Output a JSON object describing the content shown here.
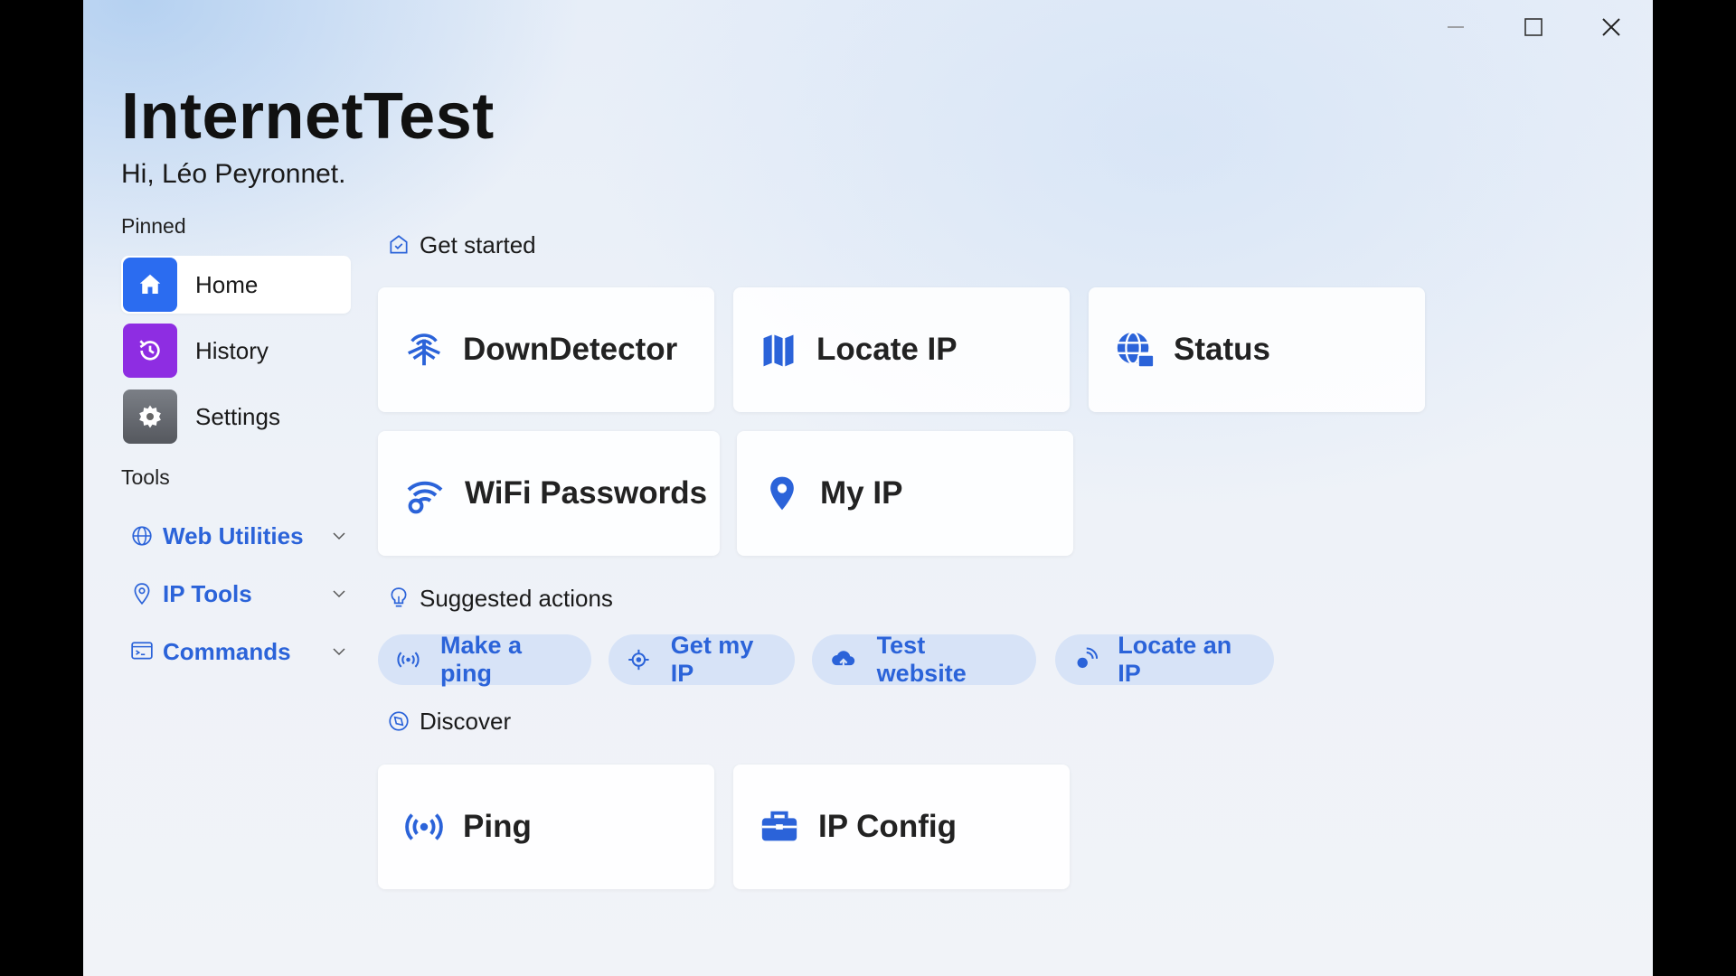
{
  "app": {
    "title": "InternetTest",
    "greeting": "Hi, Léo Peyronnet."
  },
  "sidebar": {
    "pinned_label": "Pinned",
    "pinned": [
      {
        "label": "Home",
        "icon": "home-icon",
        "color": "#2b6cf0",
        "active": true
      },
      {
        "label": "History",
        "icon": "history-icon",
        "color": "#8e2de2",
        "active": false
      },
      {
        "label": "Settings",
        "icon": "gear-icon",
        "color": "#6b6f76",
        "active": false
      }
    ],
    "tools_label": "Tools",
    "tools": [
      {
        "label": "Web Utilities",
        "icon": "globe-icon"
      },
      {
        "label": "IP Tools",
        "icon": "location-pin-icon"
      },
      {
        "label": "Commands",
        "icon": "terminal-icon"
      }
    ]
  },
  "main": {
    "get_started": {
      "label": "Get started",
      "cards": [
        {
          "label": "DownDetector",
          "icon": "antenna-icon"
        },
        {
          "label": "Locate IP",
          "icon": "map-icon"
        },
        {
          "label": "Status",
          "icon": "globe-status-icon"
        },
        {
          "label": "WiFi Passwords",
          "icon": "wifi-key-icon"
        },
        {
          "label": "My IP",
          "icon": "location-pin-icon"
        }
      ]
    },
    "suggested": {
      "label": "Suggested actions",
      "chips": [
        {
          "label": "Make a ping",
          "icon": "ping-icon"
        },
        {
          "label": "Get my IP",
          "icon": "target-icon"
        },
        {
          "label": "Test website",
          "icon": "cloud-upload-icon"
        },
        {
          "label": "Locate an IP",
          "icon": "locate-icon"
        }
      ]
    },
    "discover": {
      "label": "Discover",
      "cards": [
        {
          "label": "Ping",
          "icon": "ping-icon"
        },
        {
          "label": "IP Config",
          "icon": "toolbox-icon"
        }
      ]
    }
  },
  "colors": {
    "accent": "#2b63d9",
    "chip_bg": "#d7e3f7"
  }
}
